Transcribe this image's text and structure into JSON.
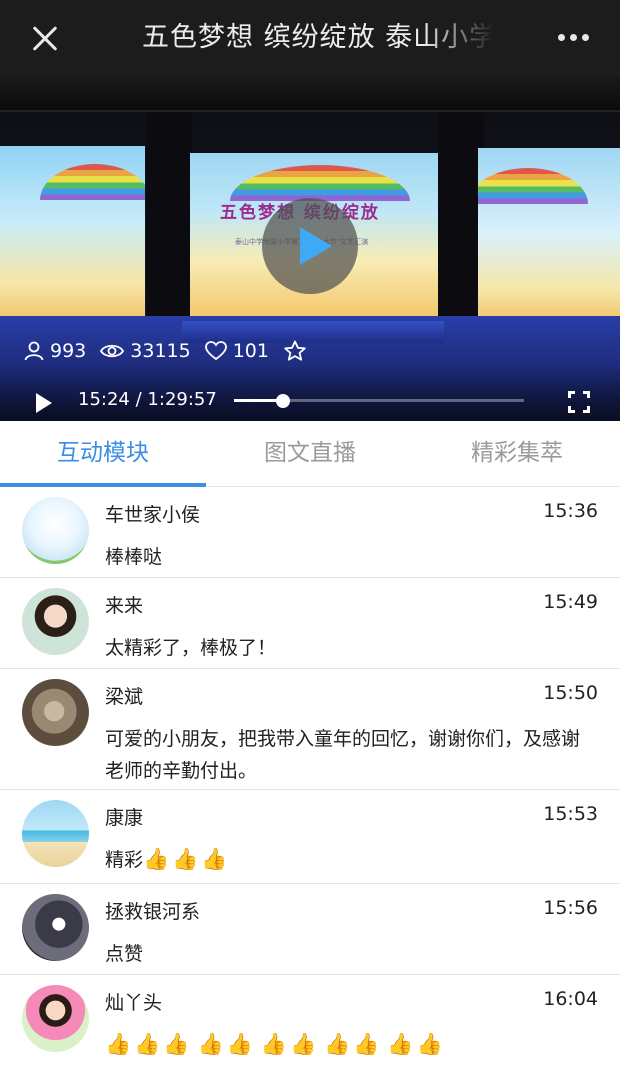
{
  "header": {
    "title": "五色梦想  缤纷绽放 泰山小学",
    "close_icon": "close-icon",
    "more_icon": "more-icon"
  },
  "video": {
    "screen_title": "五色梦想  缤纷绽放",
    "screen_subtitle": "泰山中学附属小学第二届“艺术节”文艺汇演",
    "stats": {
      "participants": "993",
      "views": "33115",
      "likes": "101"
    },
    "current_time": "15:24",
    "time_separator": "/",
    "duration": "1:29:57",
    "progress": 0.17
  },
  "tabs": [
    {
      "label": "互动模块",
      "active": true
    },
    {
      "label": "图文直播",
      "active": false
    },
    {
      "label": "精彩集萃",
      "active": false
    }
  ],
  "colors": {
    "accent": "#3a8fe4",
    "play_button_arrow": "#3fa9f5"
  },
  "comments": [
    {
      "user": "车世家小侯",
      "time": "15:36",
      "text": "棒棒哒",
      "thumbs": 0
    },
    {
      "user": "来来",
      "time": "15:49",
      "text": "太精彩了，棒极了！",
      "thumbs": 0
    },
    {
      "user": "梁斌",
      "time": "15:50",
      "text": "可爱的小朋友，把我带入童年的回忆，谢谢你们，及感谢老师的辛勤付出。",
      "thumbs": 0
    },
    {
      "user": "康康",
      "time": "15:53",
      "text": "精彩",
      "thumbs": 3
    },
    {
      "user": "拯救银河系",
      "time": "15:56",
      "text": "点赞",
      "thumbs": 0
    },
    {
      "user": "灿丫头",
      "time": "16:04",
      "text": "",
      "thumbs": 11
    }
  ],
  "thumb_glyph": "👍"
}
